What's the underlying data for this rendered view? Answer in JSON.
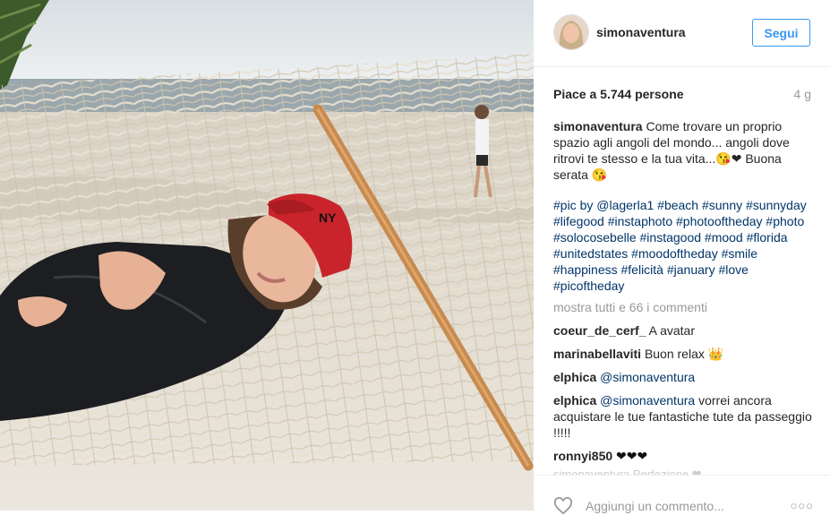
{
  "post": {
    "username": "simonaventura",
    "follow_label": "Segui",
    "likes": "Piace a 5.744 persone",
    "age": "4 g",
    "caption_user": "simonaventura",
    "caption_text": "Come trovare un proprio spazio agli angoli del mondo... angoli dove ritrovi te stesso e la tua vita...😘❤ Buona serata 😘",
    "tags": "#pic by @lagerla1 #beach #sunny #sunnyday #lifegood #instaphoto #photooftheday #photo #solocosebelle #instagood #mood #florida #unitedstates #moodoftheday #smile #happiness #felicità #january #love #picoftheday",
    "show_all": "mostra tutti e 66 i commenti",
    "comments": [
      {
        "user": "coeur_de_cerf_",
        "text": "A avatar"
      },
      {
        "user": "marinabellaviti",
        "text": "Buon relax 👑"
      },
      {
        "user": "elphica",
        "mention": "@simonaventura",
        "text": ""
      },
      {
        "user": "elphica",
        "mention": "@simonaventura",
        "text": "vorrei ancora acquistare le tue fantastiche tute da passeggio !!!!!"
      },
      {
        "user": "ronnyi850",
        "text": "❤❤❤"
      }
    ],
    "partial_comment": "simonaventura Perfezione ❤",
    "add_comment_placeholder": "Aggiungi un commento...",
    "more_icon": "more-options-icon",
    "heart_icon": "heart-icon"
  }
}
